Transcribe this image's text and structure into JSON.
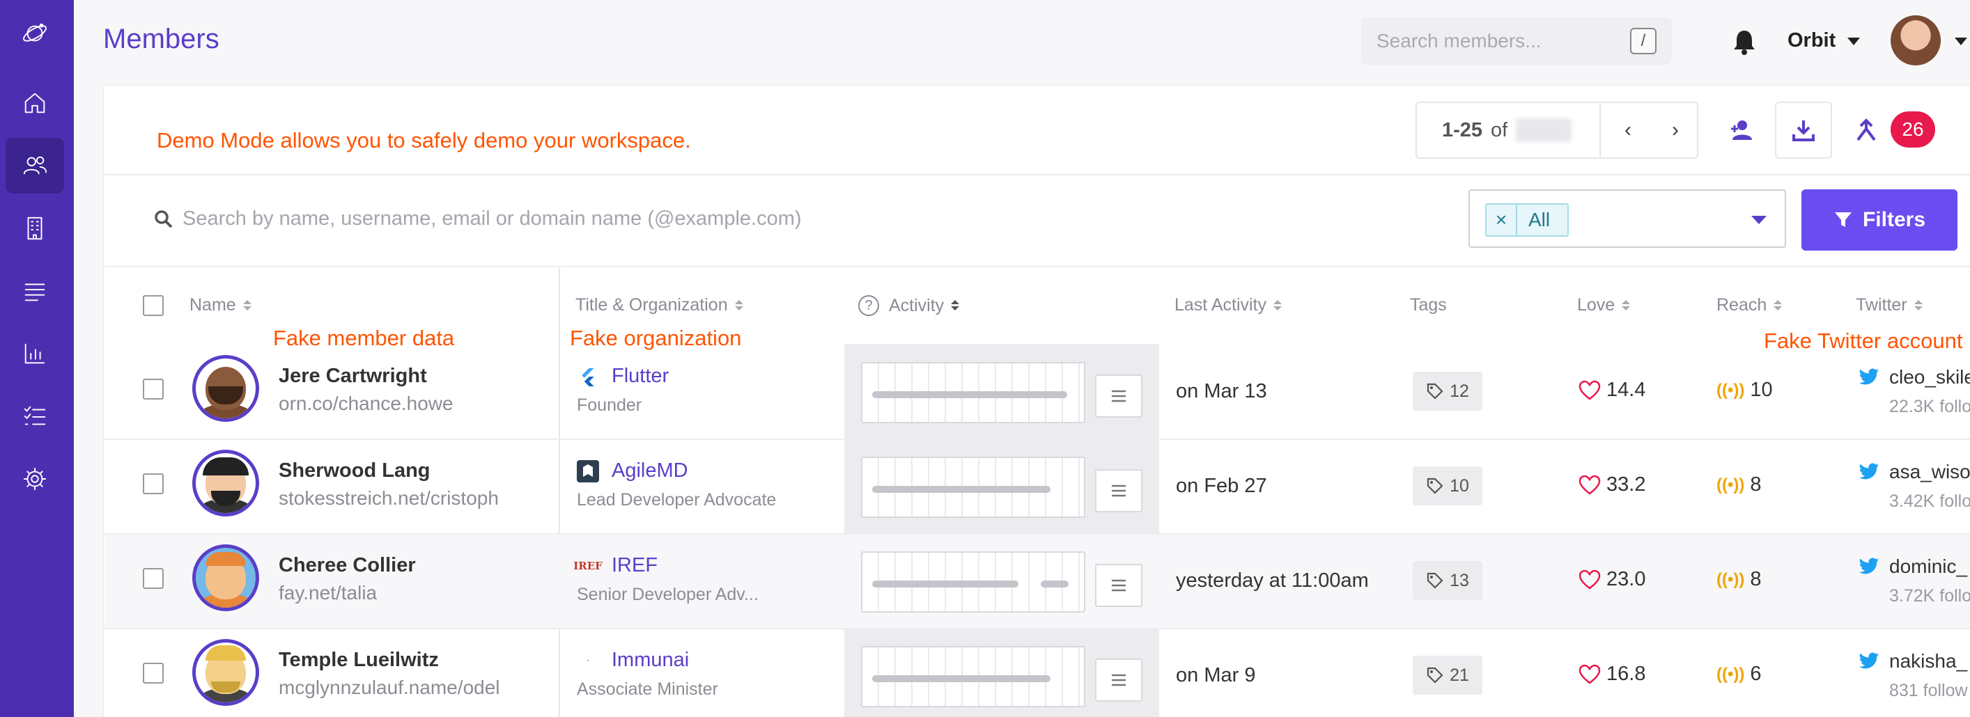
{
  "app": {
    "title": "Members",
    "workspace": "Orbit"
  },
  "search": {
    "placeholder": "Search members...",
    "shortcut": "/"
  },
  "sidebar": {
    "items": [
      {
        "name": "home"
      },
      {
        "name": "members"
      },
      {
        "name": "organizations"
      },
      {
        "name": "activities"
      },
      {
        "name": "reports"
      },
      {
        "name": "tasks"
      },
      {
        "name": "settings"
      }
    ]
  },
  "banner": {
    "text": "Demo Mode allows you to safely demo your workspace."
  },
  "pagination": {
    "range": "1-25",
    "of": "of",
    "prev": "‹",
    "next": "›"
  },
  "notifications_count": "26",
  "member_search": {
    "placeholder": "Search by name, username, email or domain name (@example.com)"
  },
  "filter": {
    "chip_remove": "×",
    "chip_label": "All",
    "button_label": "Filters"
  },
  "table": {
    "columns": [
      {
        "label": "Name"
      },
      {
        "label": "Title & Organization"
      },
      {
        "label": "Activity"
      },
      {
        "label": "Last Activity"
      },
      {
        "label": "Tags"
      },
      {
        "label": "Love"
      },
      {
        "label": "Reach"
      },
      {
        "label": "Twitter"
      }
    ],
    "annotations": {
      "name": "Fake member data",
      "org": "Fake organization",
      "twitter": "Fake Twitter account"
    },
    "rows": [
      {
        "name": "Jere Cartwright",
        "username": "orn.co/chance.howe",
        "org": "Flutter",
        "org_logo": "F",
        "title": "Founder",
        "last_activity": "on Mar 13",
        "tags": "12",
        "love": "14.4",
        "reach": "10",
        "twitter": "cleo_skile",
        "followers": "22.3K follo"
      },
      {
        "name": "Sherwood Lang",
        "username": "stokesstreich.net/cristoph",
        "org": "AgileMD",
        "org_logo": "A",
        "title": "Lead Developer Advocate",
        "last_activity": "on Feb 27",
        "tags": "10",
        "love": "33.2",
        "reach": "8",
        "twitter": "asa_wiso",
        "followers": "3.42K follo"
      },
      {
        "name": "Cheree Collier",
        "username": "fay.net/talia",
        "org": "IREF",
        "org_logo": "IREF",
        "title": "Senior Developer Adv...",
        "last_activity": "yesterday at 11:00am",
        "tags": "13",
        "love": "23.0",
        "reach": "8",
        "twitter": "dominic_",
        "followers": "3.72K follo"
      },
      {
        "name": "Temple Lueilwitz",
        "username": "mcglynnzulauf.name/odel",
        "org": "Immunai",
        "org_logo": "·",
        "title": "Associate Minister",
        "last_activity": "on Mar 9",
        "tags": "21",
        "love": "16.8",
        "reach": "6",
        "twitter": "nakisha_",
        "followers": "831 follow"
      }
    ]
  },
  "colors": {
    "sidebar": "#4c2fb1",
    "accent": "#5a3ec8",
    "annotation": "#ff5400",
    "badge": "#e8194c"
  }
}
